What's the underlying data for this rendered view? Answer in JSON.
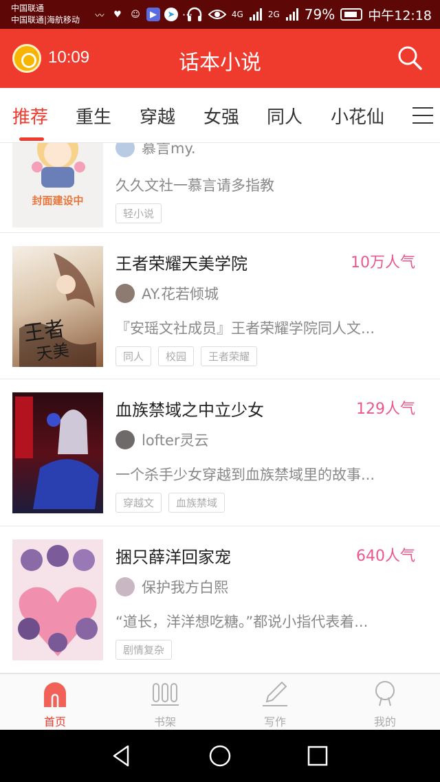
{
  "status_bar": {
    "carrier_line1": "中国联通",
    "carrier_line2": "中国联通|海航移动",
    "more": "···",
    "net1": "4G",
    "net2": "2G",
    "battery": "79%",
    "time": "中午12:18"
  },
  "header": {
    "reward_time": "10:09",
    "title": "话本小说"
  },
  "tabs": [
    "推荐",
    "重生",
    "穿越",
    "女强",
    "同人",
    "小花仙"
  ],
  "books": [
    {
      "author": "慕言my.",
      "description": "久久文社一慕言请多指教",
      "tags": [
        "轻小说"
      ],
      "cover_text": "封面建设中"
    },
    {
      "title": "王者荣耀天美学院",
      "popularity": "10万人气",
      "author": "AY.花若倾城",
      "description": "『安瑶文社成员』王者荣耀学院同人文...",
      "tags": [
        "同人",
        "校园",
        "王者荣耀"
      ]
    },
    {
      "title": "血族禁域之中立少女",
      "popularity": "129人气",
      "author": "lofter灵云",
      "description": "一个杀手少女穿越到血族禁域里的故事...",
      "tags": [
        "穿越文",
        "血族禁域"
      ]
    },
    {
      "title": "捆只薛洋回家宠",
      "popularity": "640人气",
      "author": "保护我方白熙",
      "description": "“道长，洋洋想吃糖。”都说小指代表着...",
      "tags": [
        "剧情复杂"
      ]
    }
  ],
  "bottom_nav": [
    "首页",
    "书架",
    "写作",
    "我的"
  ],
  "colors": {
    "brand_red": "#ef3b2e",
    "status_bar": "#5e0707",
    "popularity_pink": "#e8588f"
  }
}
